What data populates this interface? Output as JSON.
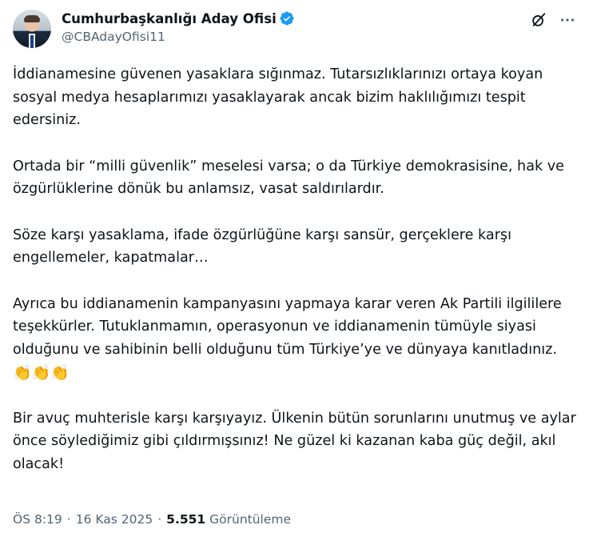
{
  "author": {
    "name": "Cumhurbaşkanlığı Aday Ofisi",
    "handle": "@CBAdayOfisi11",
    "verified": true,
    "verified_color": "#1d9bf0"
  },
  "header_icons": [
    "grok-icon",
    "more-options-icon"
  ],
  "tweet": {
    "paragraphs": [
      "İddianamesine güvenen yasaklara sığınmaz. Tutarsızlıklarınızı ortaya koyan sosyal medya hesaplarımızı yasaklayarak ancak bizim haklılığımızı tespit edersiniz.",
      "Ortada bir “milli güvenlik” meselesi varsa; o da Türkiye demokrasisine, hak ve özgürlüklerine dönük bu anlamsız, vasat saldırılardır.",
      "Söze karşı yasaklama, ifade özgürlüğüne karşı sansür, gerçeklere karşı engellemeler, kapatmalar…",
      "Ayrıca bu iddianamenin kampanyasını yapmaya karar veren Ak Partili ilgililere teşekkürler. Tutuklanmamın, operasyonun ve iddianamenin tümüyle siyasi olduğunu ve sahibinin belli olduğunu tüm Türkiye’ye ve dünyaya kanıtladınız.",
      "Bir avuç muhterisle karşı karşıyayız. Ülkenin bütün sorunlarını unutmuş ve aylar önce söylediğimiz gibi çıldırmışsınız! Ne güzel ki kazanan kaba güç değil, akıl olacak!"
    ],
    "emoji": "👏👏👏"
  },
  "meta": {
    "time": "ÖS 8:19",
    "date": "16 Kas 2025",
    "views_count": "5.551",
    "views_label": "Görüntüleme",
    "separator": "·"
  }
}
